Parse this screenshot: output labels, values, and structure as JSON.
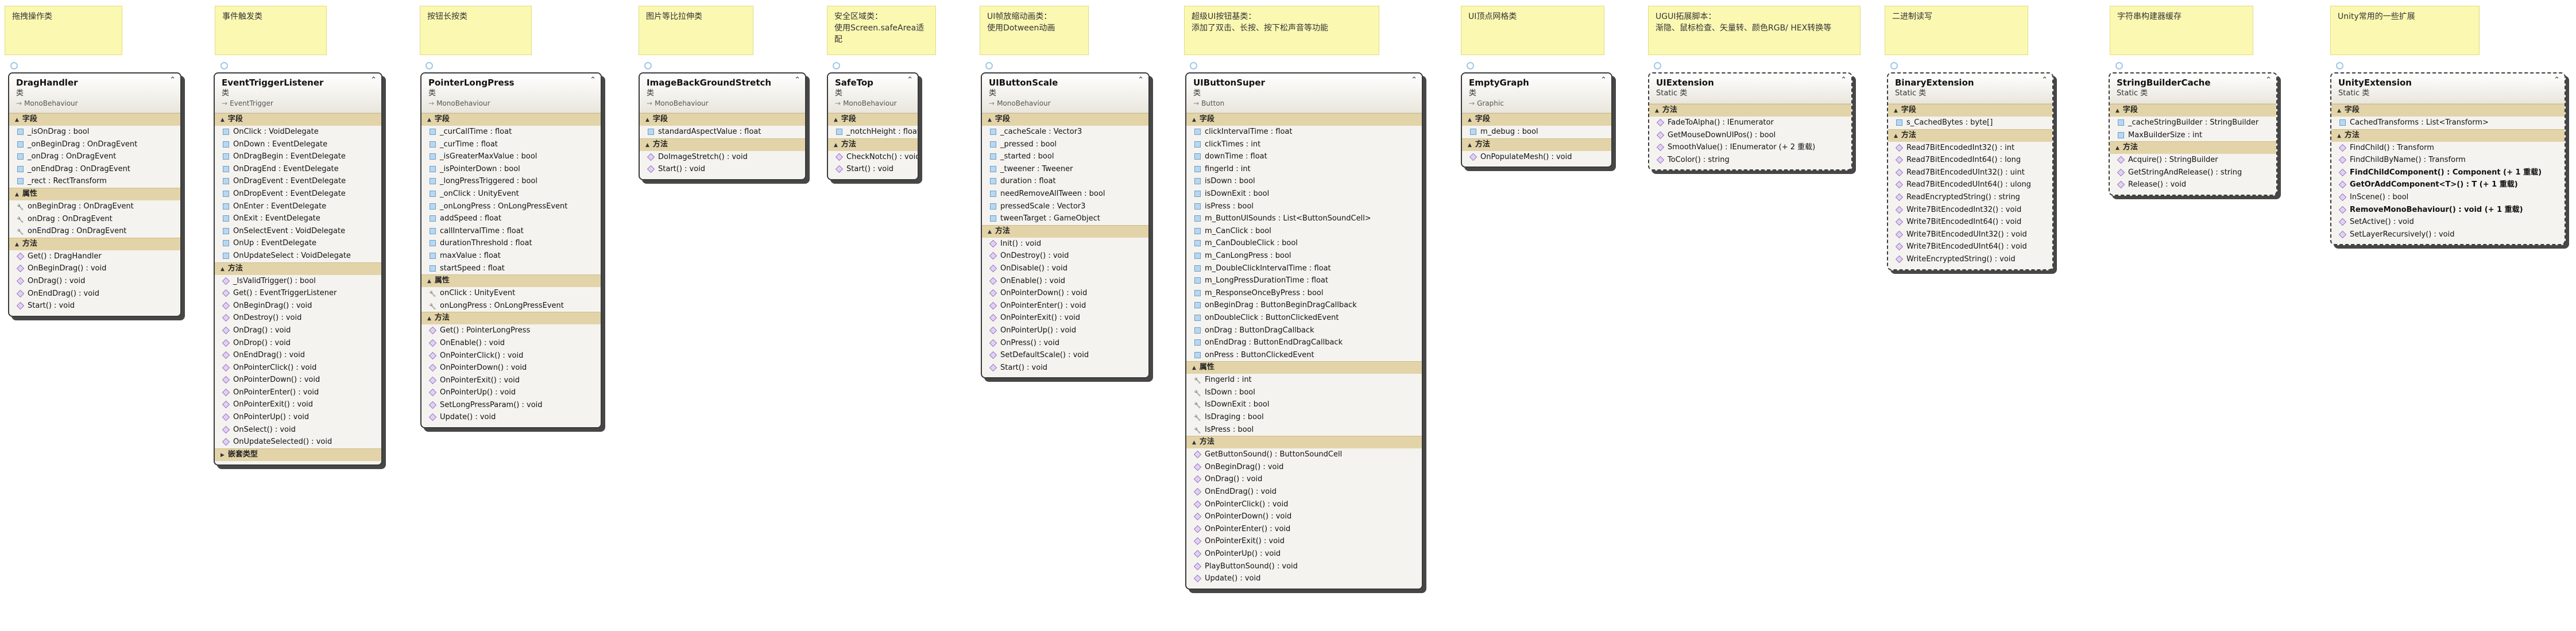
{
  "notes": [
    "拖拽操作类",
    "事件触发类",
    "按钮长按类",
    "图片等比拉伸类",
    "安全区域类：\n使用Screen.safeArea适配",
    "UI帧放缩动画类：\n使用Dotween动画",
    "超级UI按钮基类：\n添加了双击、长按、按下松声音等功能",
    "UI顶点网格类",
    "UGUI拓展脚本：\n渐隐、鼠标检查、矢量转、颜色RGB/ HEX转换等",
    "二进制读写",
    "字符串构建器缓存",
    "Unity常用的一些扩展"
  ],
  "section_labels": {
    "fields": "字段",
    "properties": "属性",
    "methods": "方法",
    "nested": "嵌套类型"
  },
  "classes": [
    {
      "name": "DragHandler",
      "kind": "类",
      "base": "MonoBehaviour",
      "fields": [
        "_isOnDrag : bool",
        "_onBeginDrag : OnDragEvent",
        "_onDrag : OnDragEvent",
        "_onEndDrag : OnDragEvent",
        "_rect : RectTransform"
      ],
      "properties": [
        "onBeginDrag : OnDragEvent",
        "onDrag : OnDragEvent",
        "onEndDrag : OnDragEvent"
      ],
      "methods": [
        "Get() : DragHandler",
        "OnBeginDrag() : void",
        "OnDrag() : void",
        "OnEndDrag() : void",
        "Start() : void"
      ]
    },
    {
      "name": "EventTriggerListener",
      "kind": "类",
      "base": "EventTrigger",
      "fields": [
        "OnClick : VoidDelegate",
        "OnDown : EventDelegate",
        "OnDragBegin : EventDelegate",
        "OnDragEnd : EventDelegate",
        "OnDragEvent : EventDelegate",
        "OnDropEvent : EventDelegate",
        "OnEnter : EventDelegate",
        "OnExit : EventDelegate",
        "OnSelectEvent : VoidDelegate",
        "OnUp : EventDelegate",
        "OnUpdateSelect : VoidDelegate"
      ],
      "methods": [
        "_IsValidTrigger() : bool",
        "Get() : EventTriggerListener",
        "OnBeginDrag() : void",
        "OnDestroy() : void",
        "OnDrag() : void",
        "OnDrop() : void",
        "OnEndDrag() : void",
        "OnPointerClick() : void",
        "OnPointerDown() : void",
        "OnPointerEnter() : void",
        "OnPointerExit() : void",
        "OnPointerUp() : void",
        "OnSelect() : void",
        "OnUpdateSelected() : void"
      ],
      "nested_collapsed": true
    },
    {
      "name": "PointerLongPress",
      "kind": "类",
      "base": "MonoBehaviour",
      "fields": [
        "_curCallTime : float",
        "_curTime : float",
        "_isGreaterMaxValue : bool",
        "_isPointerDown : bool",
        "_longPressTriggered : bool",
        "_onClick : UnityEvent",
        "_onLongPress : OnLongPressEvent",
        "addSpeed : float",
        "callIntervalTime : float",
        "durationThreshold : float",
        "maxValue : float",
        "startSpeed : float"
      ],
      "properties": [
        "onClick : UnityEvent",
        "onLongPress : OnLongPressEvent"
      ],
      "methods": [
        "Get() : PointerLongPress",
        "OnEnable() : void",
        "OnPointerClick() : void",
        "OnPointerDown() : void",
        "OnPointerExit() : void",
        "OnPointerUp() : void",
        "SetLongPressParam() : void",
        "Update() : void"
      ]
    },
    {
      "name": "ImageBackGroundStretch",
      "kind": "类",
      "base": "MonoBehaviour",
      "fields": [
        "standardAspectValue : float"
      ],
      "methods": [
        "DoImageStretch() : void",
        "Start() : void"
      ]
    },
    {
      "name": "SafeTop",
      "kind": "类",
      "base": "MonoBehaviour",
      "fields": [
        "_notchHeight : float"
      ],
      "methods": [
        "CheckNotch() : void",
        "Start() : void"
      ]
    },
    {
      "name": "UIButtonScale",
      "kind": "类",
      "base": "MonoBehaviour",
      "fields": [
        "_cacheScale : Vector3",
        "_pressed : bool",
        "_started : bool",
        "_tweener : Tweener",
        "duration : float",
        "needRemoveAllTween : bool",
        "pressedScale : Vector3",
        "tweenTarget : GameObject"
      ],
      "methods": [
        "Init() : void",
        "OnDestroy() : void",
        "OnDisable() : void",
        "OnEnable() : void",
        "OnPointerDown() : void",
        "OnPointerEnter() : void",
        "OnPointerExit() : void",
        "OnPointerUp() : void",
        "OnPress() : void",
        "SetDefaultScale() : void",
        "Start() : void"
      ]
    },
    {
      "name": "UIButtonSuper",
      "kind": "类",
      "base": "Button",
      "fields": [
        "clickIntervalTime : float",
        "clickTimes : int",
        "downTime : float",
        "fingerId : int",
        "isDown : bool",
        "isDownExit : bool",
        "isPress : bool",
        "m_ButtonUISounds : List<ButtonSoundCell>",
        "m_CanClick : bool",
        "m_CanDoubleClick : bool",
        "m_CanLongPress : bool",
        "m_DoubleClickIntervalTime : float",
        "m_LongPressDurationTime : float",
        "m_ResponseOnceByPress : bool",
        "onBeginDrag : ButtonBeginDragCallback",
        "onDoubleClick : ButtonClickedEvent",
        "onDrag : ButtonDragCallback",
        "onEndDrag : ButtonEndDragCallback",
        "onPress : ButtonClickedEvent"
      ],
      "properties": [
        "FingerId : int",
        "IsDown : bool",
        "IsDownExit : bool",
        "IsDraging : bool",
        "IsPress : bool"
      ],
      "methods": [
        "GetButtonSound() : ButtonSoundCell",
        "OnBeginDrag() : void",
        "OnDrag() : void",
        "OnEndDrag() : void",
        "OnPointerClick() : void",
        "OnPointerDown() : void",
        "OnPointerEnter() : void",
        "OnPointerExit() : void",
        "OnPointerUp() : void",
        "PlayButtonSound() : void",
        "Update() : void"
      ]
    },
    {
      "name": "EmptyGraph",
      "kind": "类",
      "base": "Graphic",
      "fields": [
        "m_debug : bool"
      ],
      "methods": [
        "OnPopulateMesh() : void"
      ]
    },
    {
      "name": "UIExtension",
      "kind": "Static 类",
      "dashed": true,
      "methods": [
        "FadeToAlpha() : IEnumerator",
        "GetMouseDownUIPos() : bool",
        "SmoothValue() : IEnumerator (+ 2 重载)",
        "ToColor() : string"
      ]
    },
    {
      "name": "BinaryExtension",
      "kind": "Static 类",
      "dashed": true,
      "fields": [
        "s_CachedBytes : byte[]"
      ],
      "methods": [
        "Read7BitEncodedInt32() : int",
        "Read7BitEncodedInt64() : long",
        "Read7BitEncodedUInt32() : uint",
        "Read7BitEncodedUInt64() : ulong",
        "ReadEncryptedString() : string",
        "Write7BitEncodedInt32() : void",
        "Write7BitEncodedInt64() : void",
        "Write7BitEncodedUInt32() : void",
        "Write7BitEncodedUInt64() : void",
        "WriteEncryptedString() : void"
      ]
    },
    {
      "name": "StringBuilderCache",
      "kind": "Static 类",
      "dashed": true,
      "fields": [
        "_cacheStringBuilder : StringBuilder",
        "MaxBuilderSize : int"
      ],
      "methods": [
        "Acquire() : StringBuilder",
        "GetStringAndRelease() : string",
        "Release() : void"
      ]
    },
    {
      "name": "UnityExtension",
      "kind": "Static 类",
      "dashed": true,
      "fields": [
        "CachedTransforms : List<Transform>"
      ],
      "methods": [
        "FindChild() : Transform",
        "FindChildByName() : Transform",
        "FindChildComponent() : Component (+ 1 重载)",
        "GetOrAddComponent<T>() : T (+ 1 重载)",
        "InScene() : bool",
        "RemoveMonoBehaviour() : void (+ 1 重载)",
        "SetActive() : void",
        "SetLayerRecursively() : void"
      ],
      "bold_methods": [
        2,
        3,
        5
      ]
    }
  ]
}
